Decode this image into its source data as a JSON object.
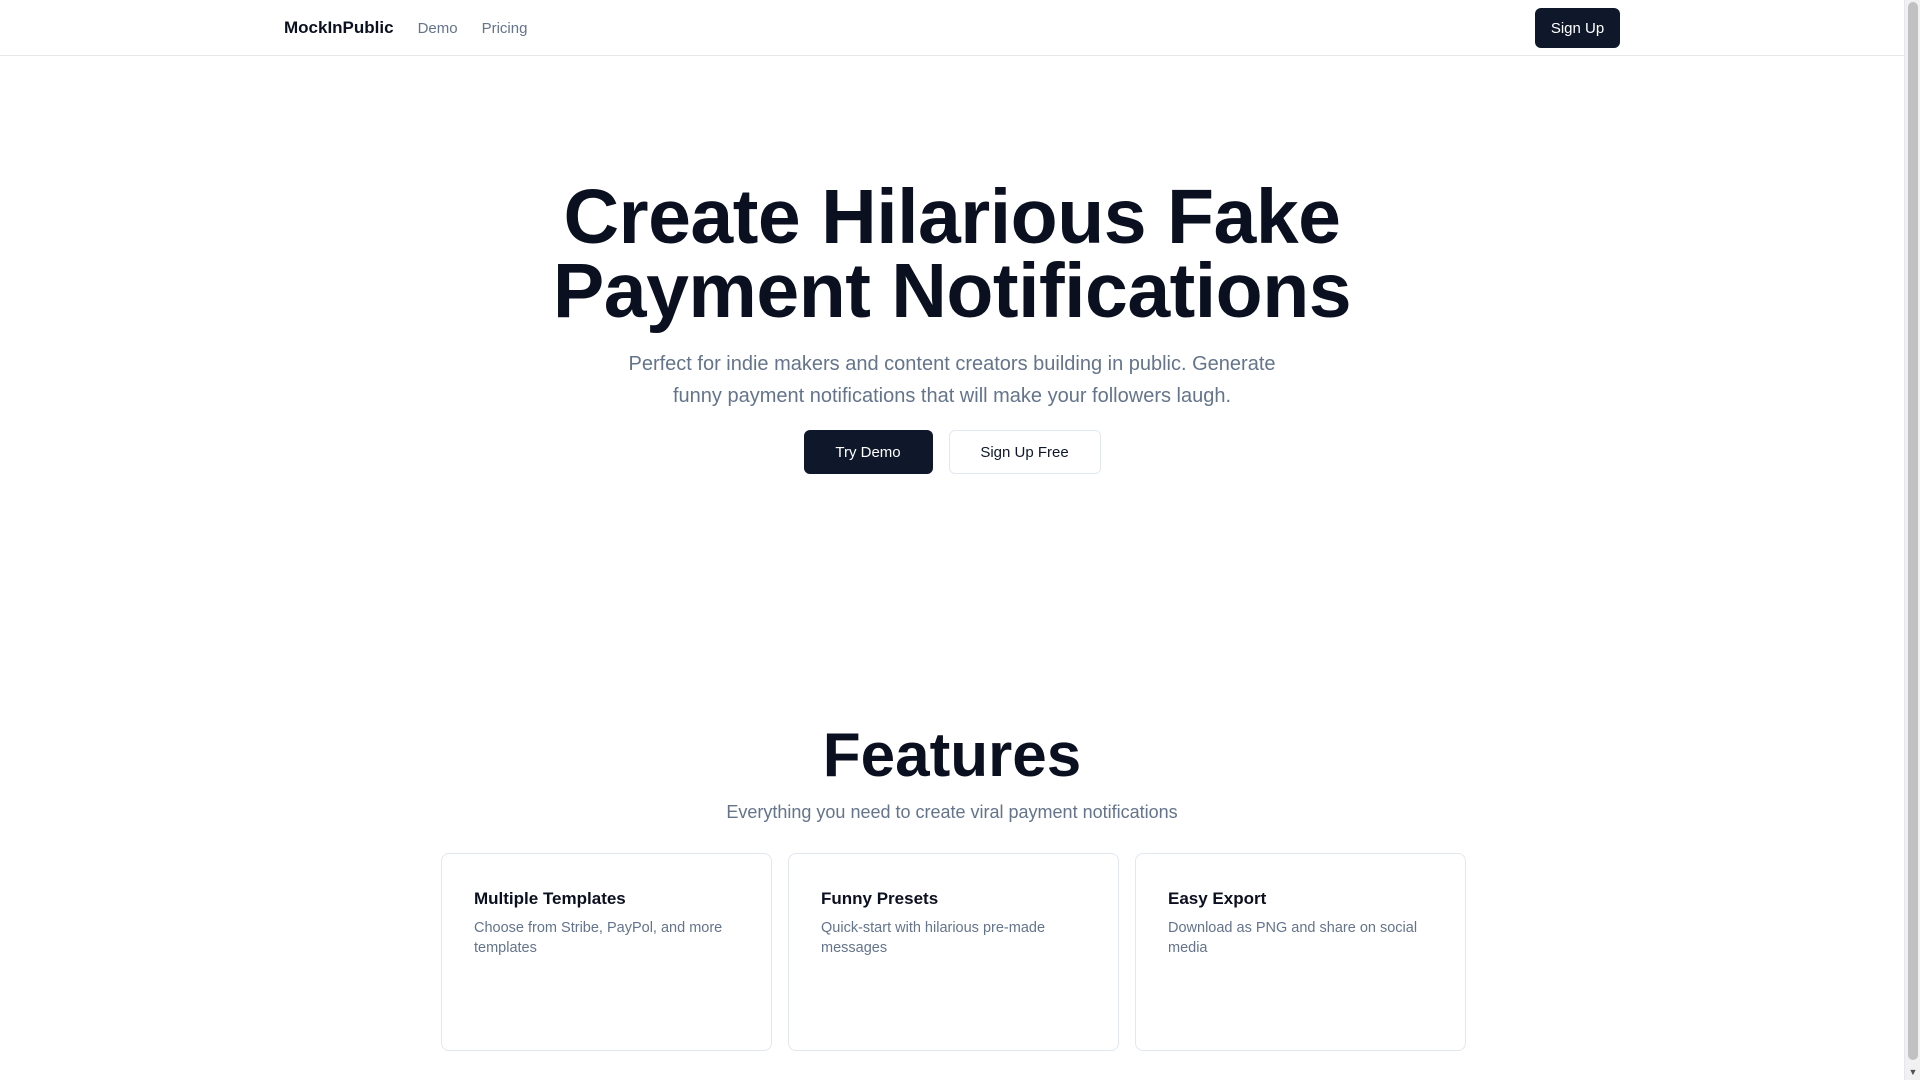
{
  "header": {
    "brand": "MockInPublic",
    "nav": [
      {
        "label": "Demo"
      },
      {
        "label": "Pricing"
      }
    ],
    "signup_label": "Sign Up"
  },
  "hero": {
    "title": "Create Hilarious Fake Payment Notifications",
    "subtitle": "Perfect for indie makers and content creators building in public. Generate funny payment notifications that will make your followers laugh.",
    "primary_cta": "Try Demo",
    "secondary_cta": "Sign Up Free"
  },
  "features": {
    "title": "Features",
    "subtitle": "Everything you need to create viral payment notifications",
    "cards": [
      {
        "title": "Multiple Templates",
        "description": "Choose from Stribe, PayPol, and more templates"
      },
      {
        "title": "Funny Presets",
        "description": "Quick-start with hilarious pre-made messages"
      },
      {
        "title": "Easy Export",
        "description": "Download as PNG and share on social media"
      }
    ]
  },
  "icons": {
    "scroll_down": "chevron-down-icon"
  },
  "colors": {
    "primary_dark": "#0f172a",
    "muted_text": "#64748b",
    "border": "#e2e8f0"
  }
}
